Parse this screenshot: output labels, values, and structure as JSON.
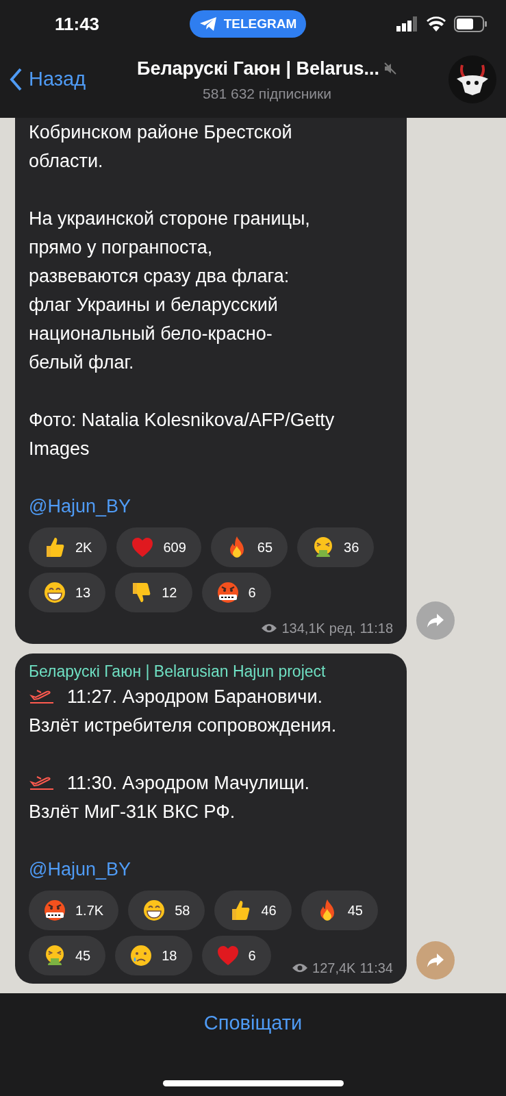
{
  "status_bar": {
    "time": "11:43",
    "app_pill": "TELEGRAM"
  },
  "header": {
    "back": "Назад",
    "title": "Беларускі Гаюн | Belarus...",
    "muted": true,
    "subtitle": "581 632 підписники"
  },
  "messages": [
    {
      "paragraphs": [
        {
          "lines": [
            "Кобринском районе Брестской",
            "области."
          ]
        },
        {
          "lines": [
            "На украинской стороне границы,",
            "прямо у погранпоста,",
            "развеваются сразу два флага:",
            "флаг Украины и беларусский",
            "национальный бело-красно-",
            "белый флаг."
          ]
        },
        {
          "lines": [
            "Фото: Natalia Kolesnikova/AFP/Getty",
            "Images"
          ]
        }
      ],
      "link": "@Hajun_BY",
      "reactions": [
        {
          "kind": "thumbs-up",
          "count": "2K"
        },
        {
          "kind": "heart",
          "count": "609"
        },
        {
          "kind": "fire",
          "count": "65"
        },
        {
          "kind": "vomit",
          "count": "36"
        },
        {
          "kind": "grin",
          "count": "13"
        },
        {
          "kind": "thumbs-down",
          "count": "12"
        },
        {
          "kind": "swear",
          "count": "6"
        }
      ],
      "views": "134,1K",
      "time": "ред. 11:18"
    },
    {
      "author": "Беларускі Гаюн | Belarusian Hajun project",
      "paragraphs": [
        {
          "plane": true,
          "lines": [
            "11:27. Аэродром Барановичи.",
            "Взлёт истребителя сопровождения."
          ]
        },
        {
          "plane": true,
          "lines": [
            "11:30. Аэродром Мачулищи.",
            "Взлёт МиГ-31К ВКС РФ."
          ]
        }
      ],
      "link": "@Hajun_BY",
      "reactions": [
        {
          "kind": "swear",
          "count": "1.7K"
        },
        {
          "kind": "grin",
          "count": "58"
        },
        {
          "kind": "thumbs-up",
          "count": "46"
        },
        {
          "kind": "fire",
          "count": "45"
        },
        {
          "kind": "vomit",
          "count": "45"
        },
        {
          "kind": "cry",
          "count": "18"
        },
        {
          "kind": "heart",
          "count": "6"
        }
      ],
      "views": "127,4K",
      "time": "11:34"
    }
  ],
  "bottom_button": "Сповіщати"
}
